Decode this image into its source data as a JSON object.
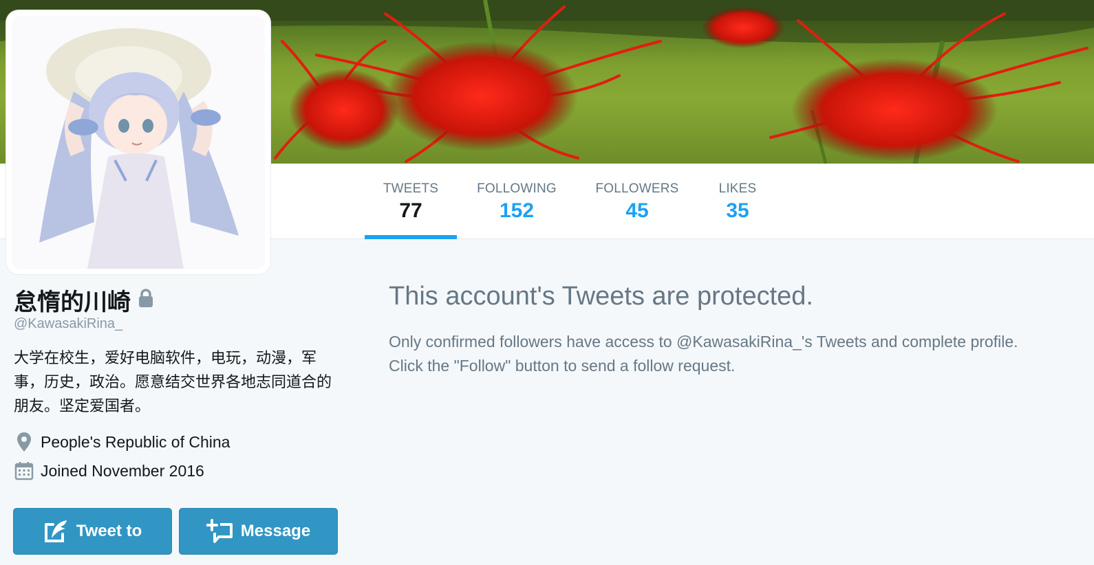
{
  "profile": {
    "display_name": "怠惰的川崎",
    "handle": "@KawasakiRina_",
    "bio": "大学在校生，爱好电脑软件，电玩，动漫，军事，历史，政治。愿意结交世界各地志同道合的朋友。坚定爱国者。",
    "location": "People's Republic of China",
    "joined": "Joined November 2016",
    "protected_icon": "lock-icon"
  },
  "stats": [
    {
      "label": "TWEETS",
      "value": "77",
      "active": true
    },
    {
      "label": "FOLLOWING",
      "value": "152",
      "active": false
    },
    {
      "label": "FOLLOWERS",
      "value": "45",
      "active": false
    },
    {
      "label": "LIKES",
      "value": "35",
      "active": false
    }
  ],
  "actions": {
    "tweet_to_label": "Tweet to",
    "message_label": "Message"
  },
  "protected": {
    "title": "This account's Tweets are protected.",
    "line1": "Only confirmed followers have access to @KawasakiRina_'s Tweets and complete profile.",
    "line2": "Click the \"Follow\" button to send a follow request."
  },
  "colors": {
    "accent": "#1da1f2",
    "button": "#3196c4",
    "muted_text": "#657786",
    "background": "#f5f8fa"
  }
}
